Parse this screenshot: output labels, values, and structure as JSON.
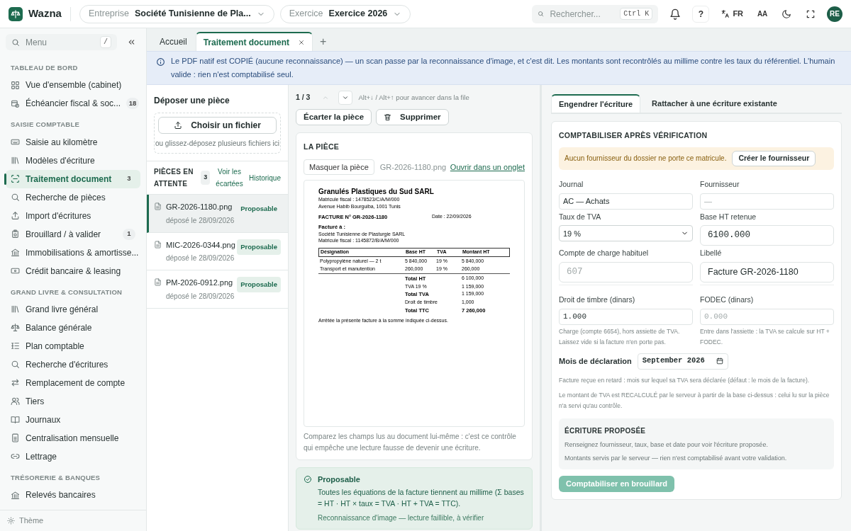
{
  "app": {
    "name": "Wazna",
    "avatar": "RE"
  },
  "header": {
    "company_label": "Entreprise",
    "company_value": "Société Tunisienne de Pla...",
    "exercise_label": "Exercice",
    "exercise_value": "Exercice 2026",
    "search_placeholder": "Rechercher...",
    "search_shortcut": "Ctrl K",
    "help": "?",
    "language": "FR",
    "text_size": "AA"
  },
  "sidebar": {
    "search_placeholder": "Menu",
    "search_key": "/",
    "footer": "Thème",
    "sections": [
      {
        "title": "TABLEAU DE BORD",
        "items": [
          {
            "label": "Vue d'ensemble (cabinet)",
            "selected": false
          },
          {
            "label": "Échéancier fiscal & soc...",
            "badge": "18",
            "selected": false
          }
        ]
      },
      {
        "title": "SAISIE COMPTABLE",
        "items": [
          {
            "label": "Saisie au kilomètre",
            "selected": false
          },
          {
            "label": "Modèles d'écriture",
            "selected": false
          },
          {
            "label": "Traitement document",
            "badge": "3",
            "selected": true
          },
          {
            "label": "Recherche de pièces",
            "selected": false
          },
          {
            "label": "Import d'écritures",
            "selected": false
          },
          {
            "label": "Brouillard / à valider",
            "badge": "1",
            "selected": false
          },
          {
            "label": "Immobilisations & amortisse...",
            "selected": false
          },
          {
            "label": "Crédit bancaire & leasing",
            "selected": false
          }
        ]
      },
      {
        "title": "GRAND LIVRE & CONSULTATION",
        "items": [
          {
            "label": "Grand livre général",
            "selected": false
          },
          {
            "label": "Balance générale",
            "selected": false
          },
          {
            "label": "Plan comptable",
            "selected": false
          },
          {
            "label": "Recherche d'écritures",
            "selected": false
          },
          {
            "label": "Remplacement de compte",
            "selected": false
          },
          {
            "label": "Tiers",
            "selected": false
          },
          {
            "label": "Journaux",
            "selected": false
          },
          {
            "label": "Centralisation mensuelle",
            "selected": false
          },
          {
            "label": "Lettrage",
            "selected": false
          }
        ]
      },
      {
        "title": "TRÉSORERIE & BANQUES",
        "items": [
          {
            "label": "Relevés bancaires",
            "selected": false
          }
        ]
      }
    ]
  },
  "tabs": [
    {
      "label": "Accueil",
      "selected": false,
      "closable": false
    },
    {
      "label": "Traitement document",
      "selected": true,
      "closable": true
    }
  ],
  "tab_add": "+",
  "banner": "Le PDF natif est COPIÉ (aucune reconnaissance) — un scan passe par la reconnaissance d'image, et c'est dit. Les montants sont recontrôlés au millime contre les taux du référentiel. L'humain valide : rien n'est comptabilisé seul.",
  "upload": {
    "title": "Déposer une pièce",
    "button": "Choisir un fichier",
    "hint": "ou glissez-déposez plusieurs fichiers ici"
  },
  "queue": {
    "title": "PIÈCES EN ATTENTE",
    "count": "3",
    "discarded_link": "Voir les écartées",
    "history_link": "Historique",
    "items": [
      {
        "name": "GR-2026-1180.png",
        "date": "déposé le 28/09/2026",
        "status": "Proposable",
        "selected": true
      },
      {
        "name": "MIC-2026-0344.png",
        "date": "déposé le 28/09/2026",
        "status": "Proposable",
        "selected": false
      },
      {
        "name": "PM-2026-0912.png",
        "date": "déposé le 28/09/2026",
        "status": "Proposable",
        "selected": false
      }
    ]
  },
  "viewer": {
    "position": "1 / 3",
    "hint": "Alt+↓ / Alt+↑ pour avancer dans la file",
    "actions": [
      "Écarter la pièce",
      "Supprimer"
    ],
    "title": "LA PIÈCE",
    "hide_button": "Masquer la pièce",
    "filename": "GR-2026-1180.png",
    "open_link": "Ouvrir dans un onglet",
    "invoice": {
      "company": "Granulés Plastiques du Sud SARL",
      "company_lines": [
        "Matricule fiscal : 1478523/C/A/M/000",
        "Avenue Habib Bourguiba, 1001 Tunis"
      ],
      "number": "FACTURE N° GR-2026-1180",
      "date": "Date : 22/09/2026",
      "billed_title": "Facturé à :",
      "billed_lines": [
        "Société Tunisienne de Plasturgie SARL",
        "Matricule fiscal : 1145872/B/A/M/000"
      ],
      "columns": [
        "Désignation",
        "Base HT",
        "TVA",
        "Montant HT"
      ],
      "rows": [
        [
          "Polypropylène naturel — 2 t",
          "5 840,000",
          "19 %",
          "5 840,000"
        ],
        [
          "Transport et manutention",
          "260,000",
          "19 %",
          "260,000"
        ]
      ],
      "totals": [
        {
          "label": "Total HT",
          "value": "6 100,000",
          "bold": true
        },
        {
          "label": "TVA 19 %",
          "value": "1 159,000",
          "bold": false
        },
        {
          "label": "Total TVA",
          "value": "1 159,000",
          "bold": true
        },
        {
          "label": "Droit de timbre",
          "value": "1,000",
          "bold": false
        },
        {
          "label": "Total TTC",
          "value": "7 260,000",
          "bold": true
        }
      ],
      "footer": "Arrêtée la présente facture à la somme indiquée ci-dessus."
    },
    "caption": "Comparez les champs lus au document lui-même : c'est ce contrôle qui empêche une lecture fausse de devenir une écriture."
  },
  "check": {
    "title": "Proposable",
    "text": "Toutes les équations de la facture tiennent au millime (Σ bases = HT · HT × taux = TVA · HT + TVA = TTC).",
    "note": "Reconnaissance d'image — lecture faillible, à vérifier"
  },
  "form": {
    "tabs": [
      {
        "label": "Engendrer l'écriture",
        "selected": true
      },
      {
        "label": "Rattacher à une écriture existante",
        "selected": false
      }
    ],
    "title": "COMPTABILISER APRÈS VÉRIFICATION",
    "alert": {
      "text": "Aucun fournisseur du dossier ne porte ce matricule.",
      "button": "Créer le fournisseur"
    },
    "fields": [
      {
        "label": "Journal",
        "value": "AC — Achats",
        "kind": "input"
      },
      {
        "label": "Fournisseur",
        "placeholder": "—",
        "kind": "input"
      },
      {
        "label": "Taux de TVA",
        "value": "19 %",
        "kind": "select"
      },
      {
        "label": "Base HT retenue",
        "value": "6100.000",
        "kind": "mono"
      },
      {
        "label": "Compte de charge habituel",
        "placeholder": "607",
        "kind": "mono"
      },
      {
        "label": "Libellé",
        "value": "Facture GR-2026-1180",
        "kind": "large"
      },
      {
        "label": "Droit de timbre (dinars)",
        "value": "1.000",
        "kind": "small_mono",
        "help": "Charge (compte 6654), hors assiette de TVA. Laissez vide si la facture n'en porte pas."
      },
      {
        "label": "FODEC (dinars)",
        "placeholder": "0.000",
        "kind": "small_mono",
        "help": "Entre dans l'assiette : la TVA se calcule sur HT + FODEC."
      }
    ],
    "month_label": "Mois de déclaration",
    "month_value": "September 2026",
    "notes": [
      "Facture reçue en retard : mois sur lequel sa TVA sera déclarée (défaut : le mois de la facture).",
      "Le montant de TVA est RECALCULÉ par le serveur à partir de la base ci-dessus : celui lu sur la pièce n'a servi qu'au contrôle."
    ],
    "proposal": {
      "title": "ÉCRITURE PROPOSÉE",
      "lines": [
        "Renseignez fournisseur, taux, base et date pour voir l'écriture proposée.",
        "Montants servis par le serveur — rien n'est comptabilisé avant votre validation."
      ]
    },
    "submit": {
      "label": "Comptabiliser en brouillard",
      "disabled": true
    }
  }
}
